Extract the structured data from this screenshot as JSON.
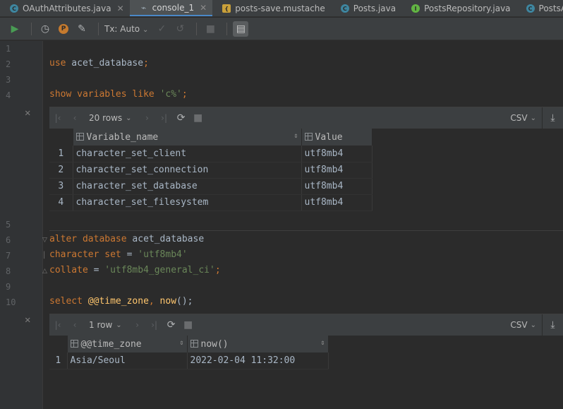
{
  "tabs": [
    {
      "label": "OAuthAttributes.java",
      "icon": "class-icon",
      "active": false,
      "closable": true
    },
    {
      "label": "console_1",
      "icon": "console-icon",
      "active": true,
      "closable": true
    },
    {
      "label": "posts-save.mustache",
      "icon": "mustache-icon",
      "active": false,
      "closable": false
    },
    {
      "label": "Posts.java",
      "icon": "class-icon",
      "active": false,
      "closable": false
    },
    {
      "label": "PostsRepository.java",
      "icon": "interface-icon",
      "active": false,
      "closable": false
    },
    {
      "label": "PostsApiContro",
      "icon": "class-icon",
      "active": false,
      "closable": false
    }
  ],
  "toolbar": {
    "tx_mode": "Tx: Auto",
    "profile_icon_letter": "P"
  },
  "line_numbers": [
    "1",
    "2",
    "3",
    "4",
    "5",
    "6",
    "7",
    "8",
    "9",
    "10"
  ],
  "code": {
    "line2": {
      "kw": "use",
      "ident": " acet_database",
      "punct": ";"
    },
    "line4": {
      "kw1": "show",
      "kw2": " variables",
      "kw3": " like",
      "sp": " ",
      "str": "'c%'",
      "punct": ";"
    },
    "line6": {
      "kw1": "alter",
      "kw2": " database",
      "ident": " acet_database"
    },
    "line7": {
      "kw1": "character",
      "kw2": " set",
      "eq": " = ",
      "str": "'utf8mb4'"
    },
    "line8": {
      "kw": "collate",
      "eq": " = ",
      "str": "'utf8mb4_general_ci'",
      "punct": ";"
    },
    "line10": {
      "kw": "select",
      "sp": " ",
      "var": "@@time_zone",
      "comma": ", ",
      "fn": "now",
      "tail": "();"
    }
  },
  "result1": {
    "rows_label": "20 rows",
    "export_label": "CSV",
    "columns": [
      "Variable_name",
      "Value"
    ],
    "rows": [
      [
        "1",
        "character_set_client",
        "utf8mb4"
      ],
      [
        "2",
        "character_set_connection",
        "utf8mb4"
      ],
      [
        "3",
        "character_set_database",
        "utf8mb4"
      ],
      [
        "4",
        "character_set_filesystem",
        "utf8mb4"
      ]
    ]
  },
  "result2": {
    "rows_label": "1 row",
    "export_label": "CSV",
    "columns": [
      "@@time_zone",
      "now()"
    ],
    "rows": [
      [
        "1",
        "Asia/Seoul",
        "2022-02-04 11:32:00"
      ]
    ]
  }
}
